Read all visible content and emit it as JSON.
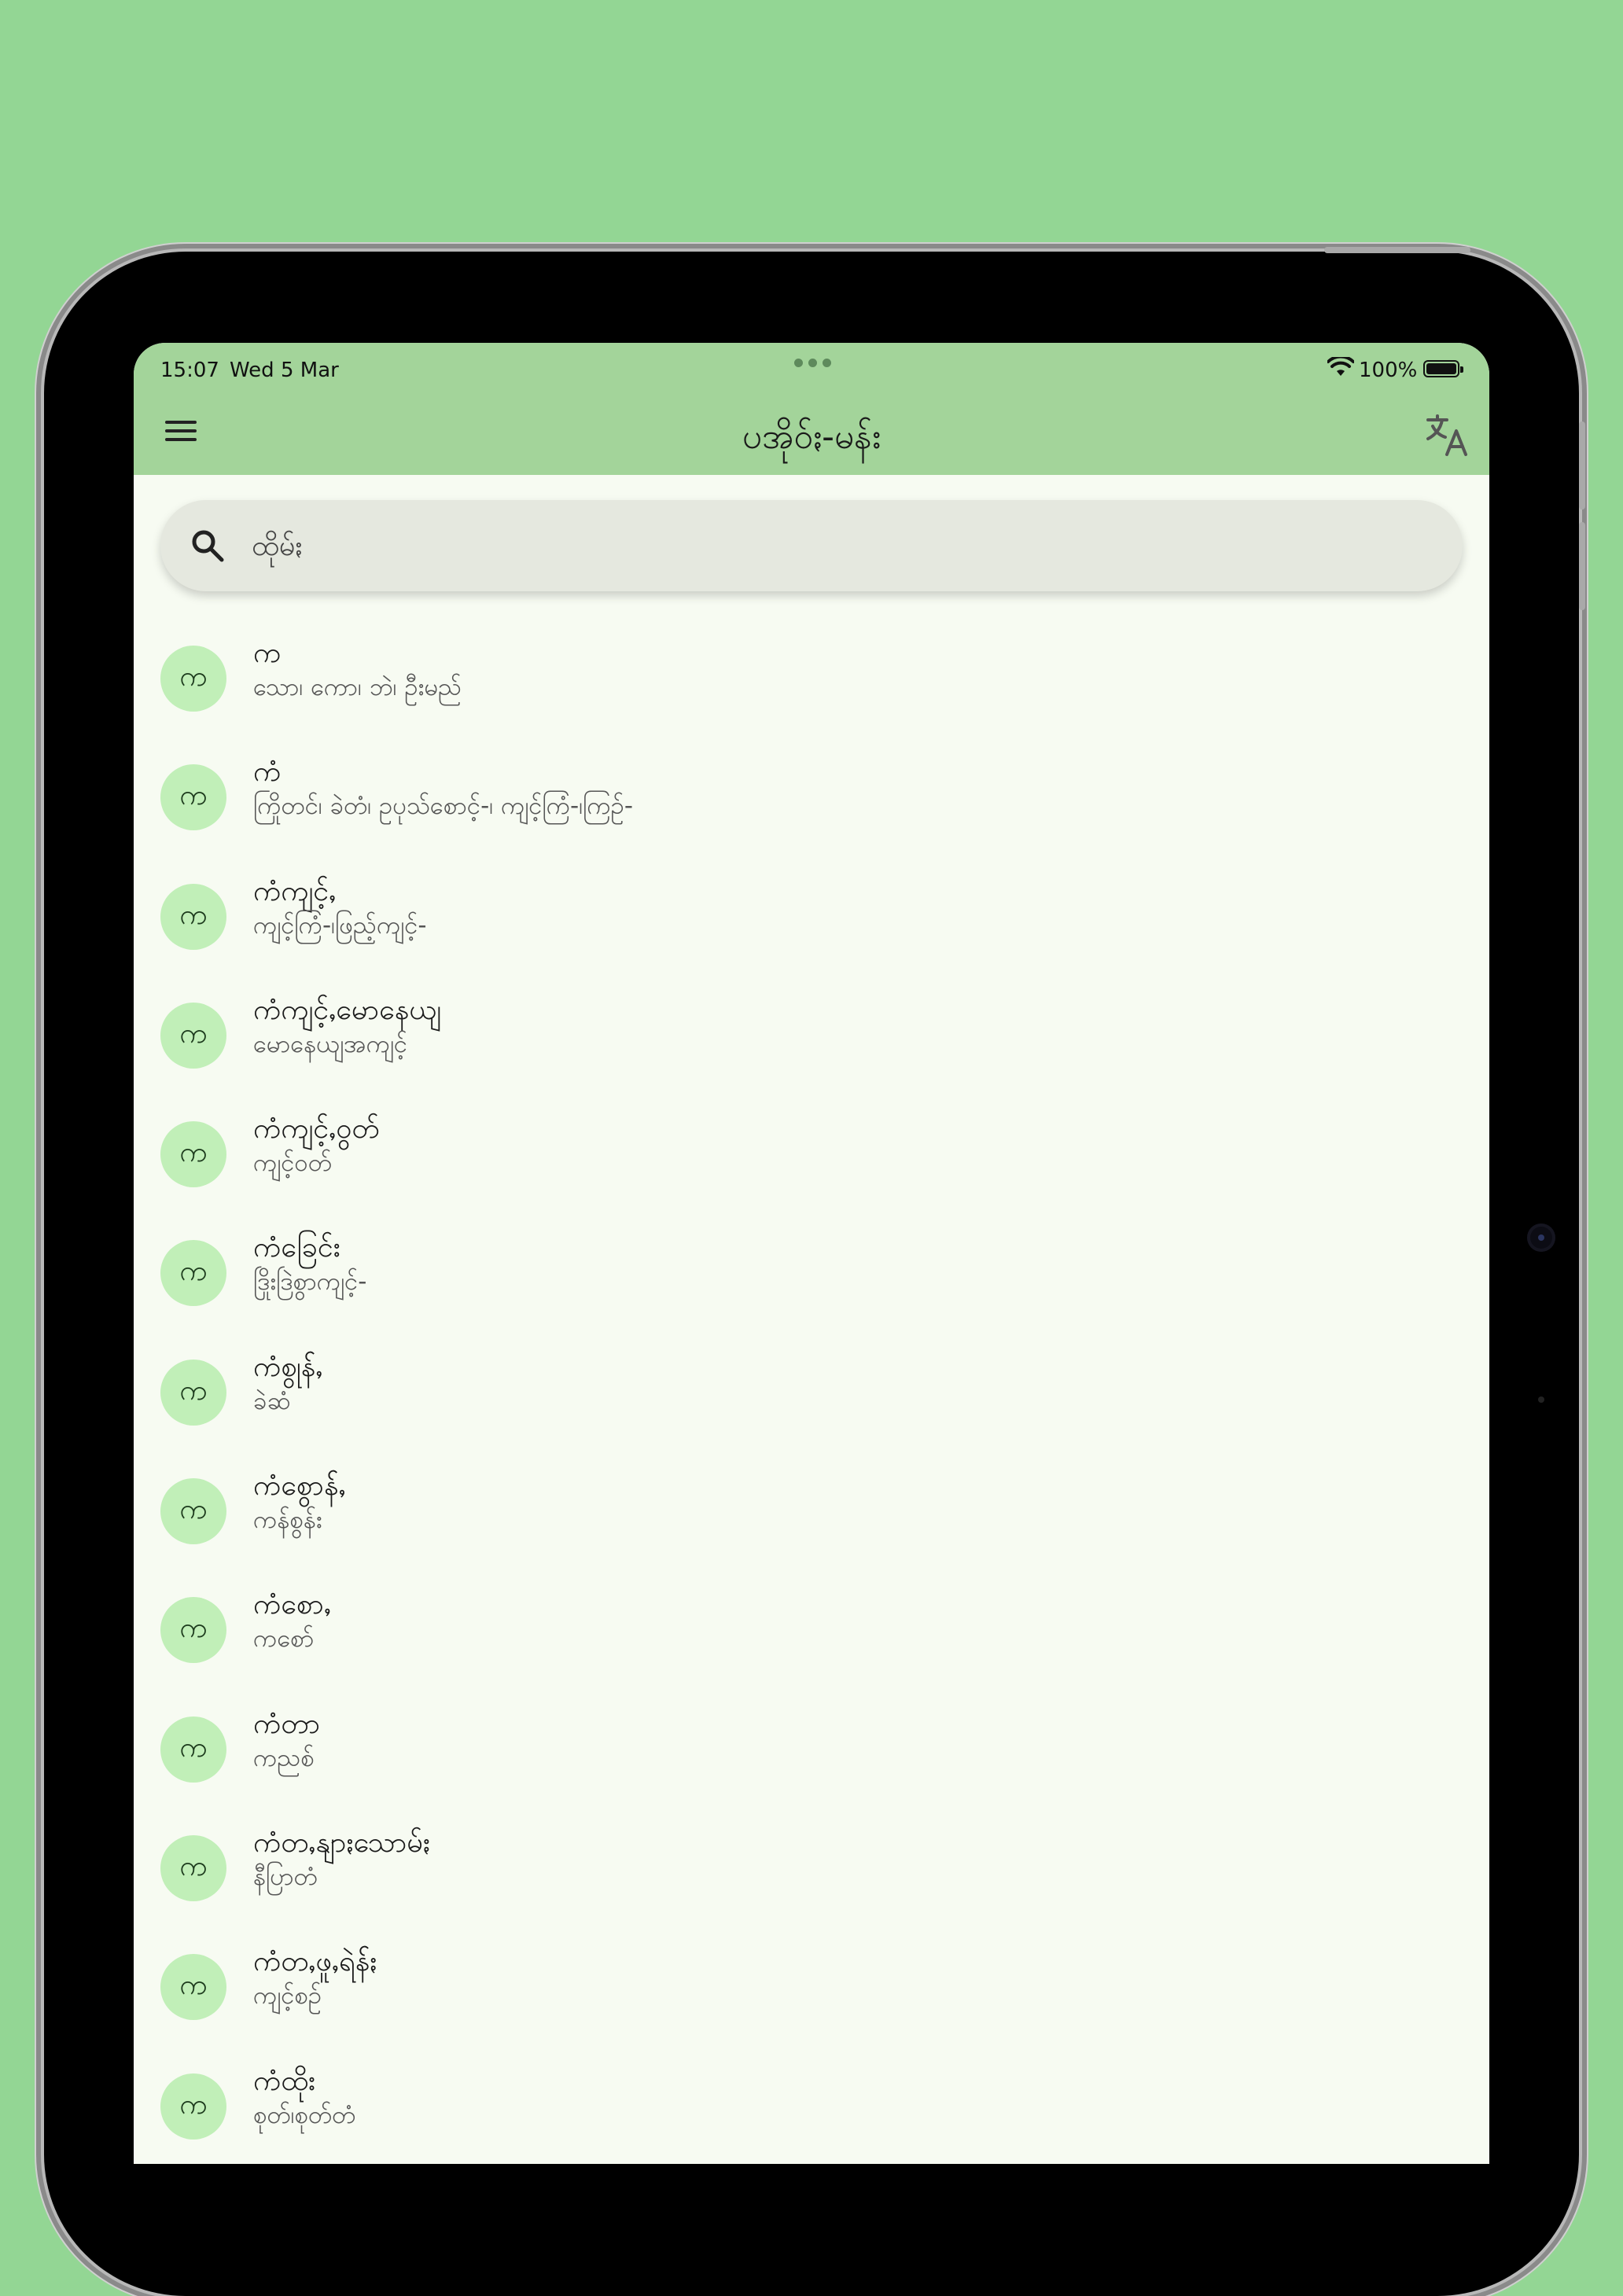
{
  "status_bar": {
    "time": "15:07",
    "date": "Wed 5 Mar",
    "battery": "100%"
  },
  "app_bar": {
    "title": "ပအိုဝ်ႏ-မန်း",
    "menu_icon": "menu-icon",
    "translate_icon": "translate-icon"
  },
  "search": {
    "placeholder": "ထိုမ်ႏ",
    "icon": "search-icon"
  },
  "colors": {
    "background": "#93d694",
    "app_bar": "#a3d49a",
    "screen": "#f7fbf2",
    "avatar": "#c1efb8"
  },
  "entries": [
    {
      "letter": "က",
      "word": "က",
      "meaning": "သော၊ ကော၊ ဘဲ၊ ဦးမည်"
    },
    {
      "letter": "က",
      "word": "ကံ",
      "meaning": "ကြိုတင်၊ ခဲတံ၊ ဥပုသ်စောင့်-၊ ကျင့်ကြံ-၊ကြဥ်-"
    },
    {
      "letter": "က",
      "word": "ကံကျင့်ႇ",
      "meaning": "ကျင့်ကြံ-၊ဖြည့်ကျင့်-"
    },
    {
      "letter": "က",
      "word": "ကံကျင့်ႇမောနေယျ",
      "meaning": "မောနေယျအကျင့်"
    },
    {
      "letter": "က",
      "word": "ကံကျင့်ႇဝွတ်",
      "meaning": "ကျင့်ဝတ်"
    },
    {
      "letter": "က",
      "word": "ကံခြေင်း",
      "meaning": "ဒြိုးဒြဲစွာကျင့်-"
    },
    {
      "letter": "က",
      "word": "ကံစွုန််ႇ",
      "meaning": "ခဲဆံ"
    },
    {
      "letter": "က",
      "word": "ကံစွောန််ႇ",
      "meaning": "ကန်စွန်း"
    },
    {
      "letter": "က",
      "word": "ကံစောႇ",
      "meaning": "ကစော်"
    },
    {
      "letter": "က",
      "word": "ကံတာ",
      "meaning": "ကညစ်"
    },
    {
      "letter": "က",
      "word": "ကံတႇနျာႏသောမ်ႏ",
      "meaning": "နီပြာတံ"
    },
    {
      "letter": "က",
      "word": "ကံတႇဖူႇရဲန််ႏ",
      "meaning": "ကျင့်စဥ်"
    },
    {
      "letter": "က",
      "word": "ကံထိုး",
      "meaning": "စုတ်၊စုတ်တံ"
    }
  ]
}
